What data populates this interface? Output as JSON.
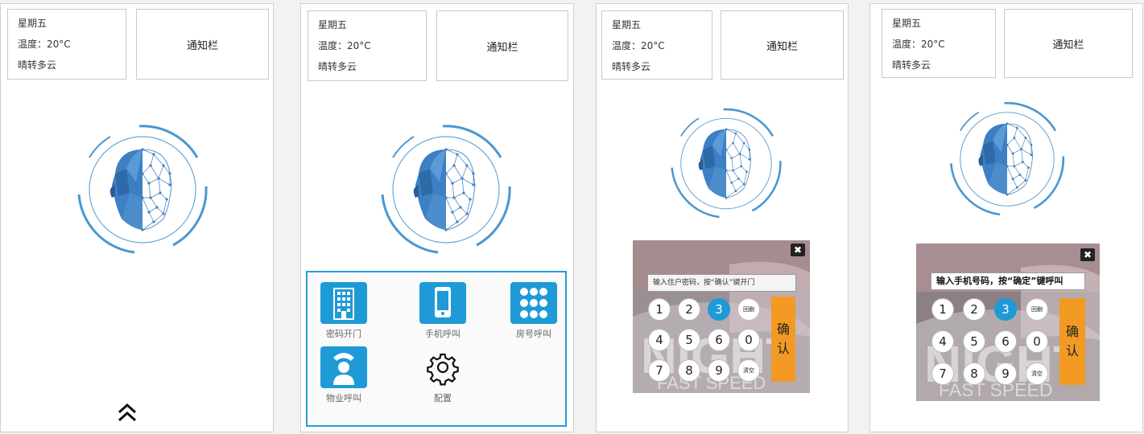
{
  "weather": {
    "day": "星期五",
    "temperature": "温度：20°C",
    "condition": "晴转多云"
  },
  "notify_label": "通知栏",
  "menu": {
    "items": [
      {
        "label": "密码开门",
        "icon": "building-icon"
      },
      {
        "label": "手机呼叫",
        "icon": "phone-icon"
      },
      {
        "label": "房号呼叫",
        "icon": "grid-icon"
      },
      {
        "label": "物业呼叫",
        "icon": "operator-icon"
      },
      {
        "label": "配置",
        "icon": "gear-icon"
      }
    ]
  },
  "keypad_password": {
    "prompt": "输入住户密码，按“确认”键开门"
  },
  "keypad_phone": {
    "prompt": "输入手机号码，按“确定”键呼叫"
  },
  "keypad": {
    "row1": [
      "1",
      "2",
      "3",
      "回删"
    ],
    "row2": [
      "4",
      "5",
      "6",
      "0"
    ],
    "row3": [
      "7",
      "8",
      "9",
      "清空"
    ],
    "active_key": "3",
    "confirm_label": "确认",
    "close_label": "✖"
  },
  "background_text": [
    "NIGHT",
    "FAST SPEED"
  ],
  "colors": {
    "accent": "#1e9ad6",
    "confirm": "#f29a23",
    "face_blue": "#3d7fc4"
  }
}
